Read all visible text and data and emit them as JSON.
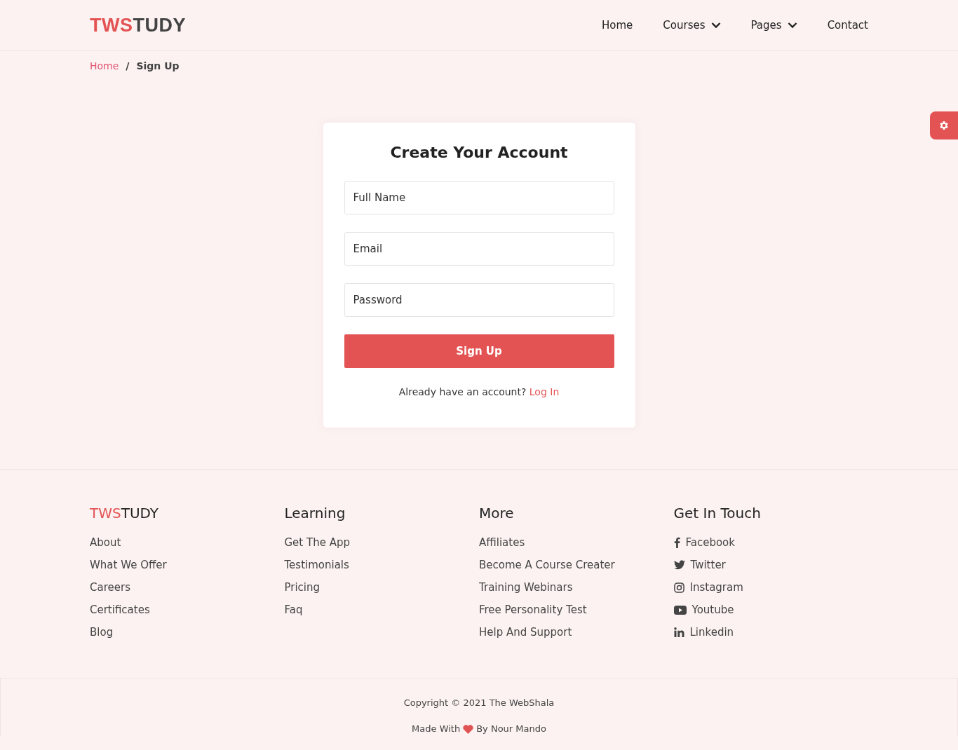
{
  "header": {
    "logo": {
      "accent": "TWS",
      "rest": "TUDY"
    },
    "nav": [
      {
        "label": "Home",
        "has_dropdown": false
      },
      {
        "label": "Courses",
        "has_dropdown": true
      },
      {
        "label": "Pages",
        "has_dropdown": true
      },
      {
        "label": "Contact",
        "has_dropdown": false
      }
    ]
  },
  "breadcrumb": [
    {
      "label": "Home",
      "current": false
    },
    {
      "label": "Sign Up",
      "current": true
    }
  ],
  "breadcrumb_separator": "/",
  "form": {
    "title": "Create Your Account",
    "fields": [
      {
        "placeholder": "Full Name"
      },
      {
        "placeholder": "Email"
      },
      {
        "placeholder": "Password"
      }
    ],
    "submit": "Sign Up",
    "prompt": "Already have an account?",
    "login_link": "Log In"
  },
  "footer": {
    "brand": {
      "accent": "TWS",
      "rest": "TUDY"
    },
    "brand_links": [
      "About",
      "What We Offer",
      "Careers",
      "Certificates",
      "Blog"
    ],
    "columns": [
      {
        "title": "Learning",
        "links": [
          "Get The App",
          "Testimonials",
          "Pricing",
          "Faq"
        ]
      },
      {
        "title": "More",
        "links": [
          "Affiliates",
          "Become A Course Creater",
          "Training Webinars",
          "Free Personality Test",
          "Help And Support"
        ]
      }
    ],
    "contact": {
      "title": "Get In Touch",
      "links": [
        {
          "kind": "facebook",
          "label": "Facebook"
        },
        {
          "kind": "twitter",
          "label": "Twitter"
        },
        {
          "kind": "instagram",
          "label": "Instagram"
        },
        {
          "kind": "youtube",
          "label": "Youtube"
        },
        {
          "kind": "linkedin",
          "label": "Linkedin"
        }
      ]
    }
  },
  "bottom": {
    "copyright": "Copyright © 2021 The WebShala",
    "made_with": "Made With",
    "author": "By Nour Mando"
  }
}
